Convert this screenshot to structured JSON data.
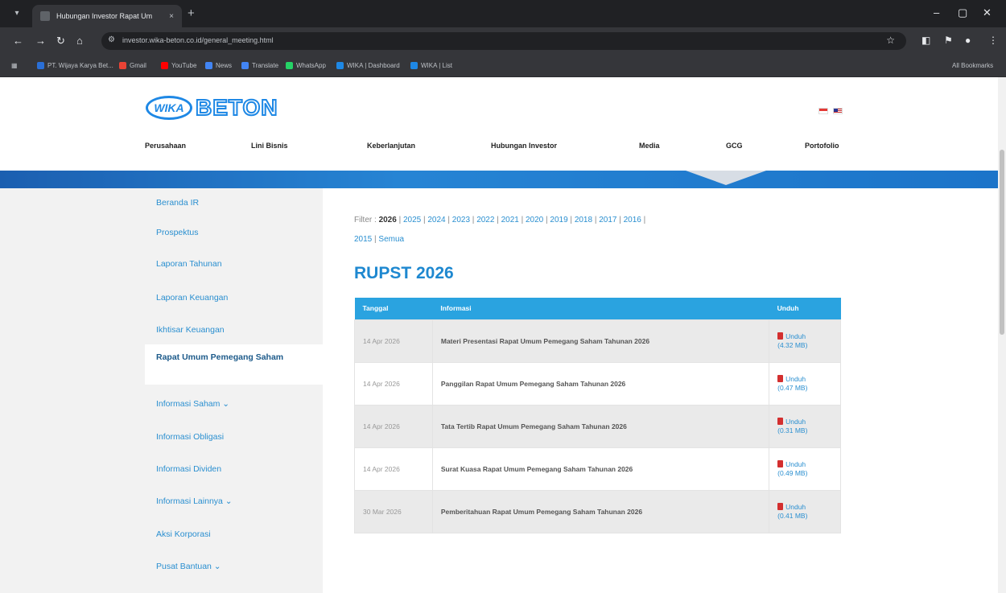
{
  "browser": {
    "tab_title": "Hubungan Investor Rapat Um",
    "tab_close": "×",
    "new_tab": "+",
    "url": "investor.wika-beton.co.id/general_meeting.html",
    "bookmarks": [
      {
        "label": "PT. Wijaya Karya Bet...",
        "color": "#2a6fd6"
      },
      {
        "label": "Gmail",
        "color": "#ea4335"
      },
      {
        "label": "YouTube",
        "color": "#ff0000"
      },
      {
        "label": "News",
        "color": "#4285f4"
      },
      {
        "label": "Translate",
        "color": "#4285f4"
      },
      {
        "label": "WhatsApp",
        "color": "#25d366"
      },
      {
        "label": "WIKA | Dashboard",
        "color": "#1e88e5"
      },
      {
        "label": "WIKA | List",
        "color": "#1e88e5"
      }
    ],
    "all_bookmarks": "All Bookmarks"
  },
  "site": {
    "logo_wika": "WIKA",
    "logo_beton": "BETON",
    "nav": [
      "Perusahaan",
      "Lini Bisnis",
      "Keberlanjutan",
      "Hubungan Investor",
      "Media",
      "GCG",
      "Portofolio"
    ]
  },
  "sidebar": {
    "items": [
      "Beranda IR",
      "Prospektus",
      "Laporan Tahunan",
      "Laporan Keuangan",
      "Ikhtisar Keuangan",
      "Rapat Umum Pemegang Saham",
      "Informasi Saham ⌄",
      "Informasi Obligasi",
      "Informasi Dividen",
      "Informasi Lainnya ⌄",
      "Aksi Korporasi",
      "Pusat Bantuan ⌄"
    ]
  },
  "main": {
    "filter_label": "Filter :",
    "current_year": "2026",
    "years": [
      "2025",
      "2024",
      "2023",
      "2022",
      "2021",
      "2020",
      "2019",
      "2018",
      "2017",
      "2016",
      "2015"
    ],
    "all_label": "Semua",
    "title": "RUPST 2026",
    "table": {
      "headers": [
        "Tanggal",
        "Informasi",
        "Unduh"
      ],
      "rows": [
        {
          "date": "14 Apr 2026",
          "info": "Materi Presentasi Rapat Umum Pemegang Saham Tahunan 2026",
          "dl": "Unduh",
          "size": "(4.32 MB)"
        },
        {
          "date": "14 Apr 2026",
          "info": "Panggilan Rapat Umum Pemegang Saham Tahunan 2026",
          "dl": "Unduh",
          "size": "(0.47 MB)"
        },
        {
          "date": "14 Apr 2026",
          "info": "Tata Tertib Rapat Umum Pemegang Saham Tahunan 2026",
          "dl": "Unduh",
          "size": "(0.31 MB)"
        },
        {
          "date": "14 Apr 2026",
          "info": "Surat Kuasa Rapat Umum Pemegang Saham Tahunan 2026",
          "dl": "Unduh",
          "size": "(0.49 MB)"
        },
        {
          "date": "30 Mar 2026",
          "info": "Pemberitahuan Rapat Umum Pemegang Saham Tahunan 2026",
          "dl": "Unduh",
          "size": "(0.41 MB)"
        }
      ]
    }
  }
}
